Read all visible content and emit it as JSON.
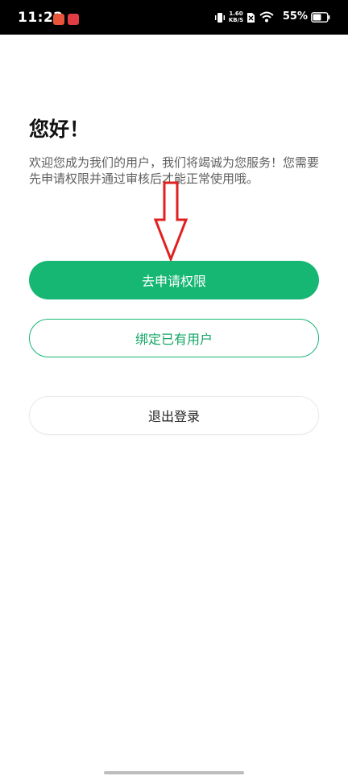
{
  "status_bar": {
    "time": "11:22",
    "network_speed_value": "1.60",
    "network_speed_unit": "KB/S",
    "battery_percent": "55%"
  },
  "content": {
    "greeting": "您好！",
    "description": "欢迎您成为我们的用户，我们将竭诚为您服务！您需要先申请权限并通过审核后才能正常使用哦。"
  },
  "buttons": {
    "apply_permission": "去申请权限",
    "bind_existing_user": "绑定已有用户",
    "logout": "退出登录"
  },
  "colors": {
    "accent": "#16b673",
    "arrow": "#e02020"
  }
}
